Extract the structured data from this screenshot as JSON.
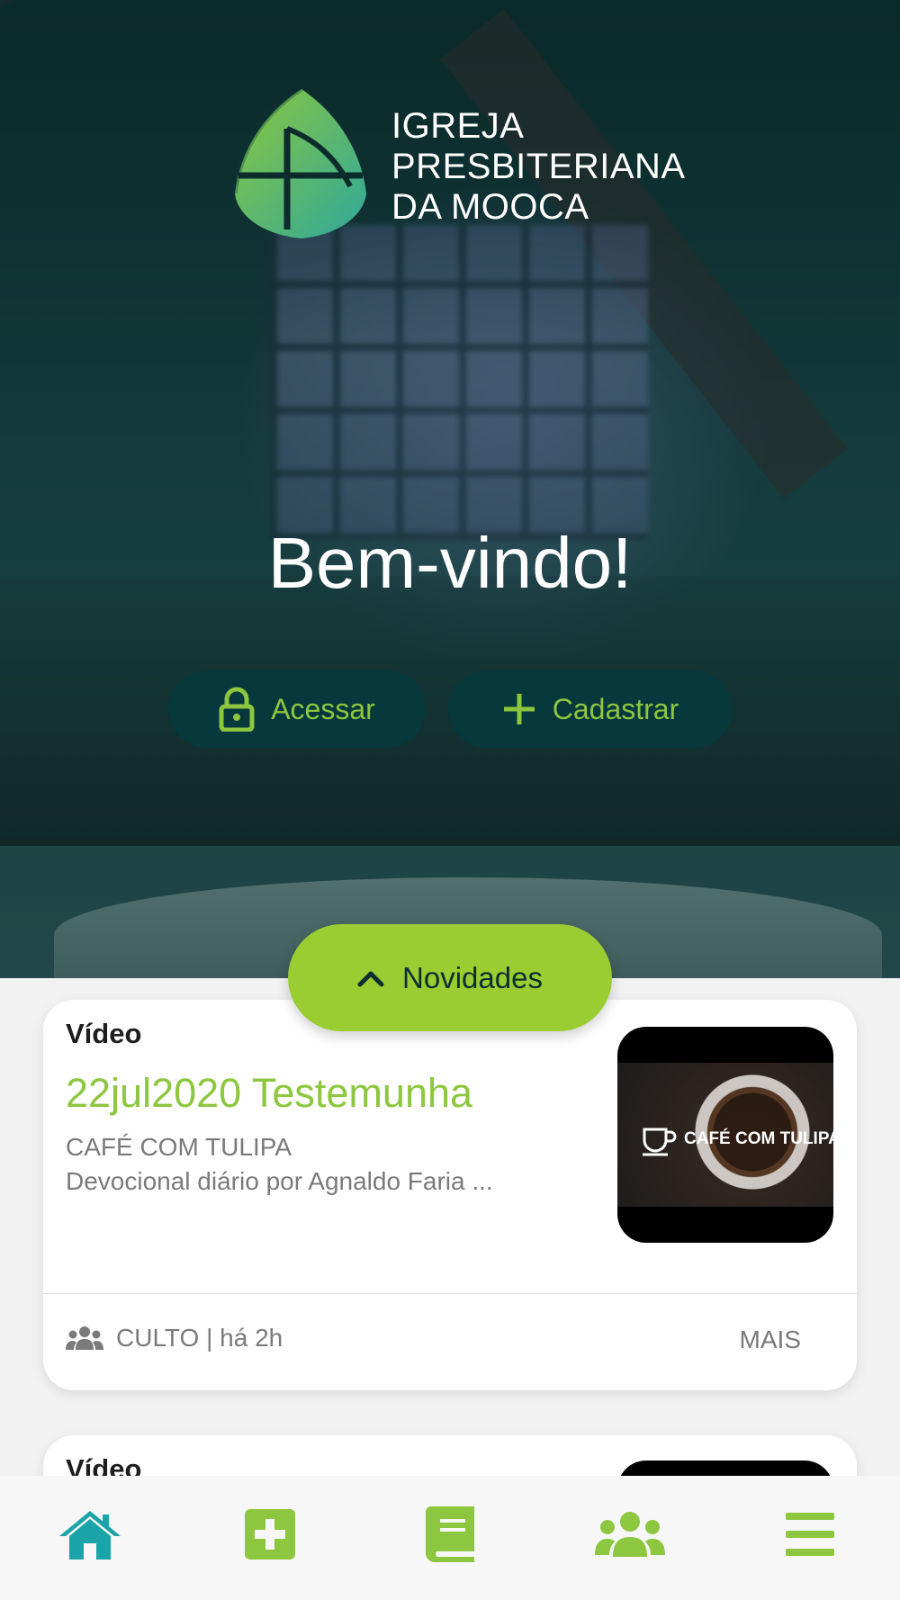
{
  "brand": {
    "name_lines": [
      "IGREJA",
      "PRESBITERIANA",
      "DA MOOCA"
    ],
    "logo_icon": "church-window-logo"
  },
  "hero": {
    "welcome": "Bem-vindo!",
    "acessar_label": "Acessar",
    "cadastrar_label": "Cadastrar"
  },
  "novidades": {
    "label": "Novidades"
  },
  "feed": [
    {
      "type": "Vídeo",
      "title": "22jul2020 Testemunha",
      "subtitle": "CAFÉ COM TULIPA",
      "description": "Devocional diário por Agnaldo Faria ...",
      "thumb_text": "CAFÉ COM TULIPA",
      "meta": "CULTO | há 2h",
      "more_label": "MAIS"
    },
    {
      "type": "Vídeo"
    }
  ],
  "tabs": [
    {
      "name": "home",
      "icon": "home-icon",
      "active": true
    },
    {
      "name": "add",
      "icon": "plus-square-icon"
    },
    {
      "name": "bible",
      "icon": "book-icon"
    },
    {
      "name": "groups",
      "icon": "users-icon"
    },
    {
      "name": "menu",
      "icon": "hamburger-icon"
    }
  ],
  "colors": {
    "accent_green": "#8dc63f",
    "novidades_bg": "#9acd32",
    "pill_bg": "#06383c",
    "home_active": "#1aa3a8"
  }
}
